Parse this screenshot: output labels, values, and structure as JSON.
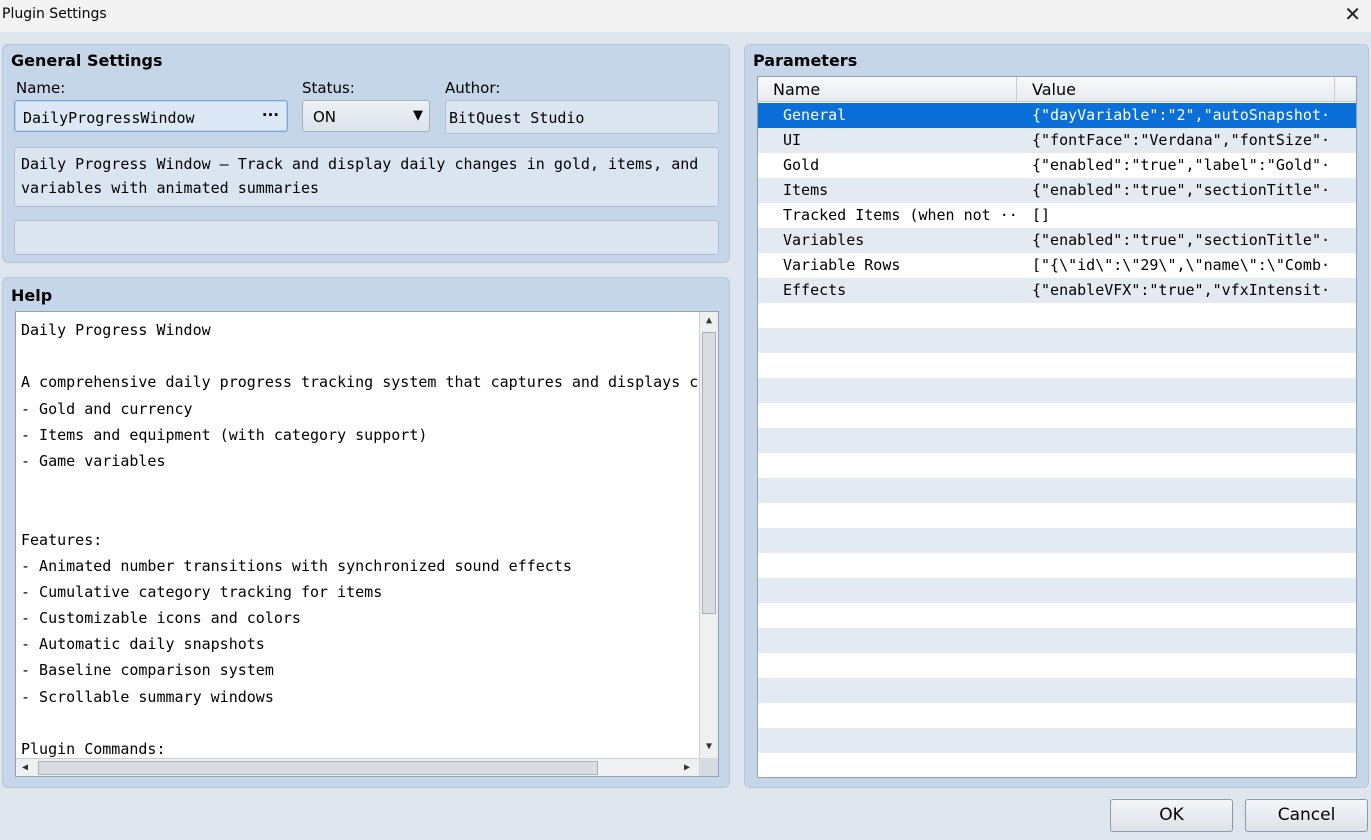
{
  "window": {
    "title": "Plugin Settings",
    "close_glyph": "✕"
  },
  "general": {
    "title": "General Settings",
    "name_label": "Name:",
    "name_value": "DailyProgressWindow",
    "name_button": "···",
    "status_label": "Status:",
    "status_value": "ON",
    "author_label": "Author:",
    "author_value": "BitQuest Studio",
    "description_line1": "Daily Progress Window – Track and display daily changes in gold, items, and",
    "description_line2": "variables with animated summaries",
    "extra_value": ""
  },
  "help": {
    "title": "Help",
    "lines": [
      "Daily Progress Window",
      "",
      "A comprehensive daily progress tracking system that captures and displays cha",
      "- Gold and currency",
      "- Items and equipment (with category support)",
      "- Game variables",
      "",
      "",
      "Features:",
      "- Animated number transitions with synchronized sound effects",
      "- Cumulative category tracking for items",
      "- Customizable icons and colors",
      "- Automatic daily snapshots",
      "- Baseline comparison system",
      "- Scrollable summary windows",
      "",
      "Plugin Commands:"
    ]
  },
  "parameters": {
    "title": "Parameters",
    "columns": {
      "name": "Name",
      "value": "Value"
    },
    "selected_row": 0,
    "rows": [
      {
        "name": "General",
        "value": "{\"dayVariable\":\"2\",\"autoSnapshot···"
      },
      {
        "name": "UI",
        "value": "{\"fontFace\":\"Verdana\",\"fontSize\"···"
      },
      {
        "name": "Gold",
        "value": "{\"enabled\":\"true\",\"label\":\"Gold\"···"
      },
      {
        "name": "Items",
        "value": "{\"enabled\":\"true\",\"sectionTitle\"···"
      },
      {
        "name": "Tracked Items (when not ···",
        "value": "[]"
      },
      {
        "name": "Variables",
        "value": "{\"enabled\":\"true\",\"sectionTitle\"···"
      },
      {
        "name": "Variable Rows",
        "value": "[\"{\\\"id\\\":\\\"29\\\",\\\"name\\\":\\\"Comb···"
      },
      {
        "name": "Effects",
        "value": "{\"enableVFX\":\"true\",\"vfxIntensit···"
      }
    ]
  },
  "buttons": {
    "ok": "OK",
    "cancel": "Cancel"
  },
  "colors": {
    "selection": "#0a6fd9",
    "panel": "#c5d6e8",
    "background": "#dfe6ee"
  }
}
